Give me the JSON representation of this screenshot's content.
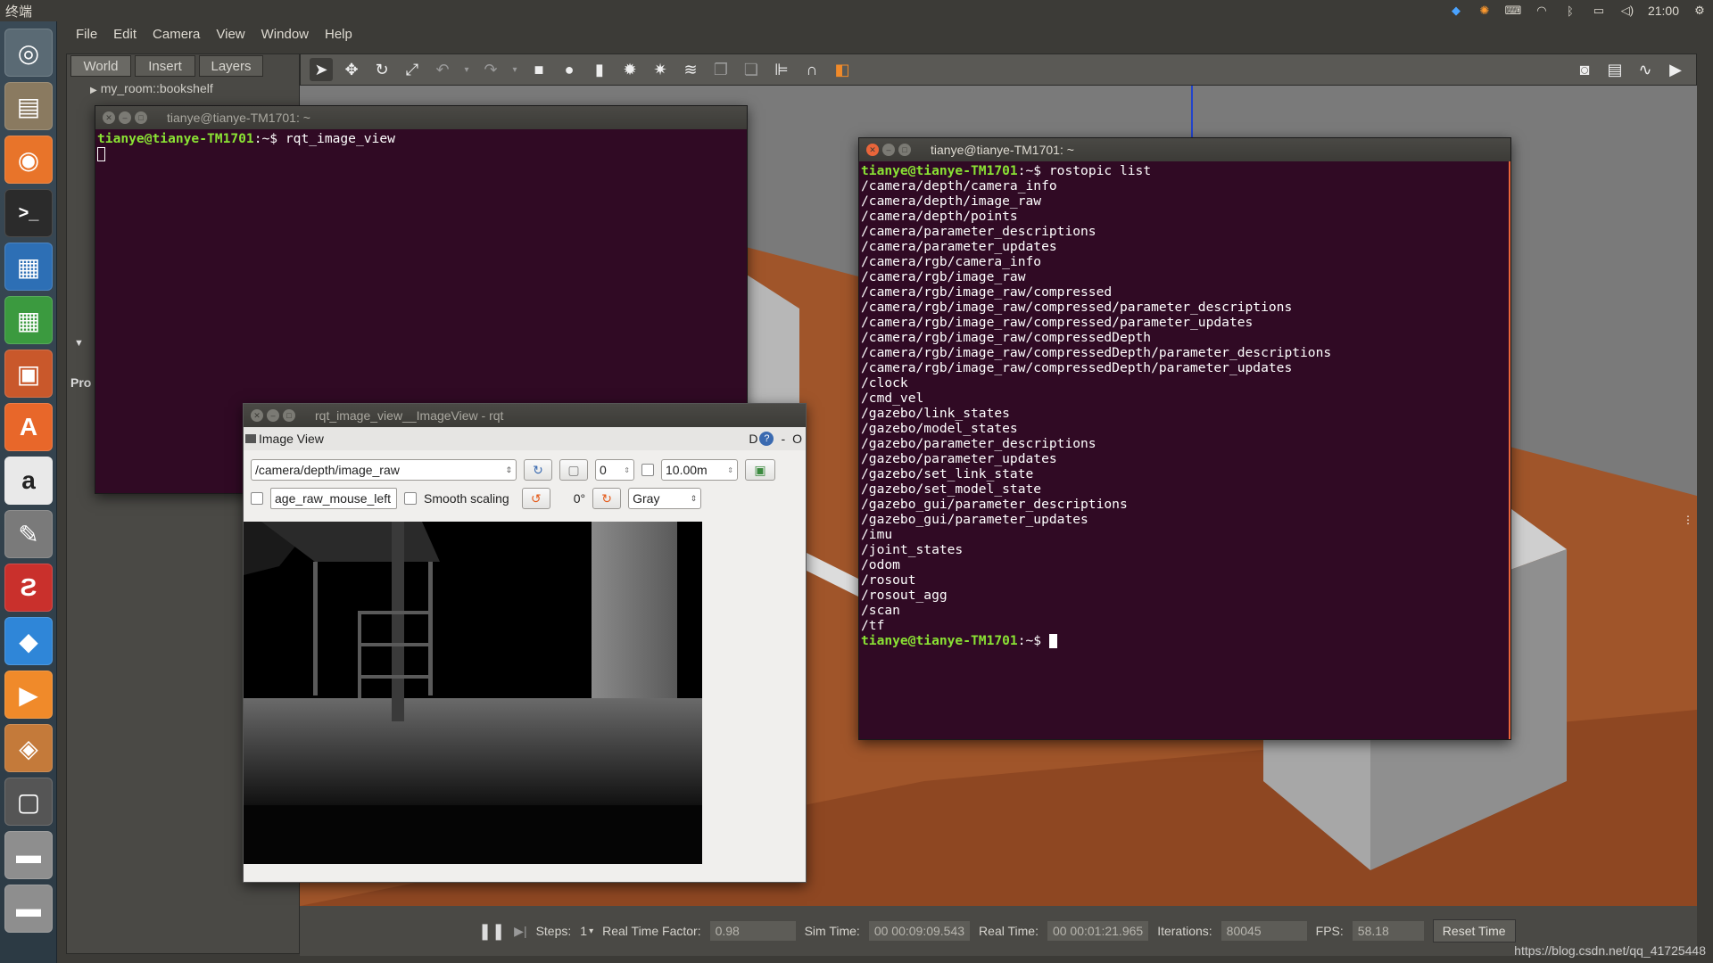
{
  "top_panel": {
    "app_title": "终端",
    "clock": "21:00"
  },
  "gazebo": {
    "menu": [
      "File",
      "Edit",
      "Camera",
      "View",
      "Window",
      "Help"
    ],
    "tabs": [
      "World",
      "Insert",
      "Layers"
    ],
    "tree_item": "my_room::bookshelf",
    "side_label": "Pro",
    "status": {
      "steps_label": "Steps:",
      "steps_value": "1",
      "rtf_label": "Real Time Factor:",
      "rtf_value": "0.98",
      "sim_label": "Sim Time:",
      "sim_value": "00 00:09:09.543",
      "real_label": "Real Time:",
      "real_value": "00 00:01:21.965",
      "iter_label": "Iterations:",
      "iter_value": "80045",
      "fps_label": "FPS:",
      "fps_value": "58.18",
      "reset_label": "Reset Time"
    },
    "watermark": "https://blog.csdn.net/qq_41725448"
  },
  "term1": {
    "title": "tianye@tianye-TM1701: ~",
    "prompt": "tianye@tianye-TM1701",
    "suffix": ":~$ ",
    "command": "rqt_image_view"
  },
  "term2": {
    "title": "tianye@tianye-TM1701: ~",
    "prompt": "tianye@tianye-TM1701",
    "suffix": ":~$ ",
    "command": "rostopic list",
    "topics": [
      "/camera/depth/camera_info",
      "/camera/depth/image_raw",
      "/camera/depth/points",
      "/camera/parameter_descriptions",
      "/camera/parameter_updates",
      "/camera/rgb/camera_info",
      "/camera/rgb/image_raw",
      "/camera/rgb/image_raw/compressed",
      "/camera/rgb/image_raw/compressed/parameter_descriptions",
      "/camera/rgb/image_raw/compressed/parameter_updates",
      "/camera/rgb/image_raw/compressedDepth",
      "/camera/rgb/image_raw/compressedDepth/parameter_descriptions",
      "/camera/rgb/image_raw/compressedDepth/parameter_updates",
      "/clock",
      "/cmd_vel",
      "/gazebo/link_states",
      "/gazebo/model_states",
      "/gazebo/parameter_descriptions",
      "/gazebo/parameter_updates",
      "/gazebo/set_link_state",
      "/gazebo/set_model_state",
      "/gazebo_gui/parameter_descriptions",
      "/gazebo_gui/parameter_updates",
      "/imu",
      "/joint_states",
      "/odom",
      "/rosout",
      "/rosout_agg",
      "/scan",
      "/tf"
    ]
  },
  "rqt": {
    "title": "rqt_image_view__ImageView - rqt",
    "dock_title": "Image View",
    "dock_right": "D",
    "topic": "/camera/depth/image_raw",
    "spin_value": "0",
    "max_range": "10.00m",
    "mouse_topic": "age_raw_mouse_left",
    "smooth_label": "Smooth scaling",
    "rotation": "0°",
    "colormap": "Gray"
  }
}
